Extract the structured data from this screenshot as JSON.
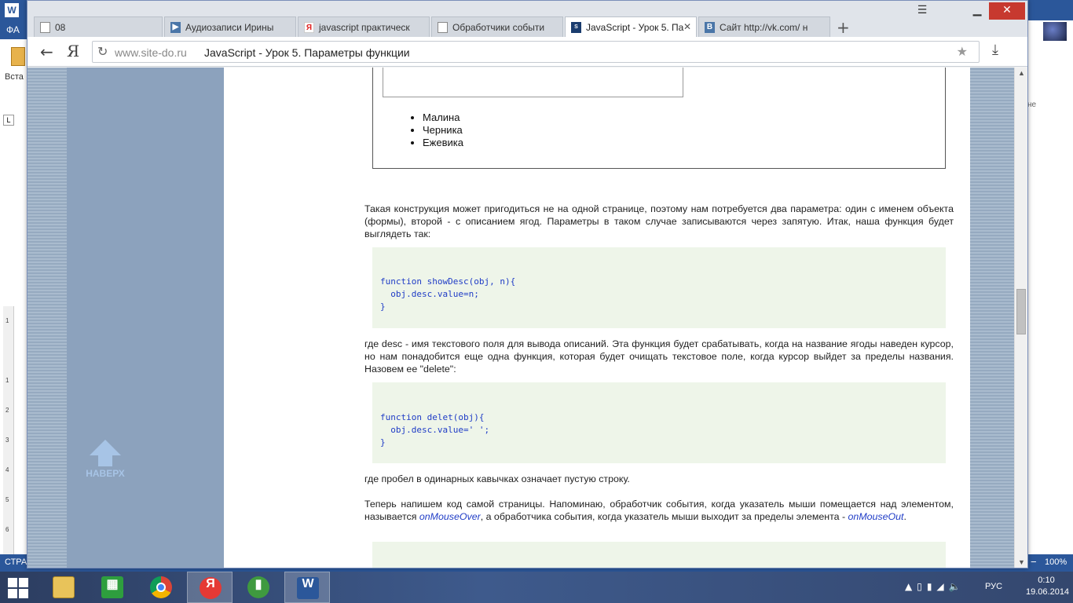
{
  "word": {
    "app_icon": "W",
    "ribbon_tab": "ФА",
    "paste_label": "Вста",
    "ruler_corner": "L",
    "ruler_numbers": [
      "1",
      "1",
      "2",
      "3",
      "4",
      "5",
      "6"
    ],
    "user_name": "а",
    "side_text": "не",
    "status_left": "СТРА",
    "zoom": "100%"
  },
  "browser": {
    "tabs": [
      {
        "label": "08",
        "icon": "page-icon",
        "active": false
      },
      {
        "label": "Аудиозаписи Ирины",
        "icon": "play-icon",
        "active": false
      },
      {
        "label": "javascript практическ",
        "icon": "yandex-icon",
        "active": false
      },
      {
        "label": "Обработчики событи",
        "icon": "page-icon",
        "active": false
      },
      {
        "label": "JavaScript - Урок 5. Па",
        "icon": "site-icon",
        "active": true
      },
      {
        "label": "Сайт http://vk.com/ н",
        "icon": "vk-icon",
        "active": false
      }
    ],
    "new_tab": "+",
    "yandex_letter": "Я",
    "url_domain": "www.site-do.ru",
    "url_title": "JavaScript - Урок 5. Параметры функции"
  },
  "page": {
    "berries": [
      "Малина",
      "Черника",
      "Ежевика"
    ],
    "para1": "Такая конструкция может пригодиться не на одной странице, поэтому нам потребуется два параметра: один с именем объекта (формы), второй - с описанием ягод. Параметры в таком случае записываются через запятую. Итак, наша функция будет выглядеть так:",
    "code1": "function showDesc(obj, n){\n  obj.desc.value=n;\n}",
    "para2": "где desc - имя текстового поля для вывода описаний. Эта функция будет срабатывать, когда на название ягоды наведен курсор, но нам понадобится еще одна функция, которая будет очищать текстовое поле, когда курсор выйдет за пределы названия. Назовем ее \"delete\":",
    "code2": "function delet(obj){\n  obj.desc.value=' ';\n}",
    "para3": "где пробел в одинарных кавычках означает пустую строку.",
    "para4_start": "Теперь напишем код самой страницы. Напоминаю, обработчик события, когда указатель мыши помещается над элементом, называется ",
    "para4_term1": "onMouseOver",
    "para4_middle": ", а обработчика события, когда указатель мыши выходит за пределы элемента - ",
    "para4_term2": "onMouseOut",
    "para4_end": ".",
    "to_top_label": "НАВЕРХ"
  },
  "taskbar": {
    "apps": [
      {
        "name": "file-explorer",
        "glyph": ""
      },
      {
        "name": "store",
        "glyph": ""
      },
      {
        "name": "chrome",
        "glyph": ""
      },
      {
        "name": "yandex-browser",
        "glyph": "Я"
      },
      {
        "name": "stats-app",
        "glyph": ""
      },
      {
        "name": "word",
        "glyph": "W"
      }
    ],
    "language": "РУС",
    "time": "0:10",
    "date": "19.06.2014"
  },
  "colors": {
    "word_blue": "#2b579a",
    "code_background": "#eef5e9",
    "code_text": "#1f3cc6",
    "close_red": "#c7392f"
  }
}
